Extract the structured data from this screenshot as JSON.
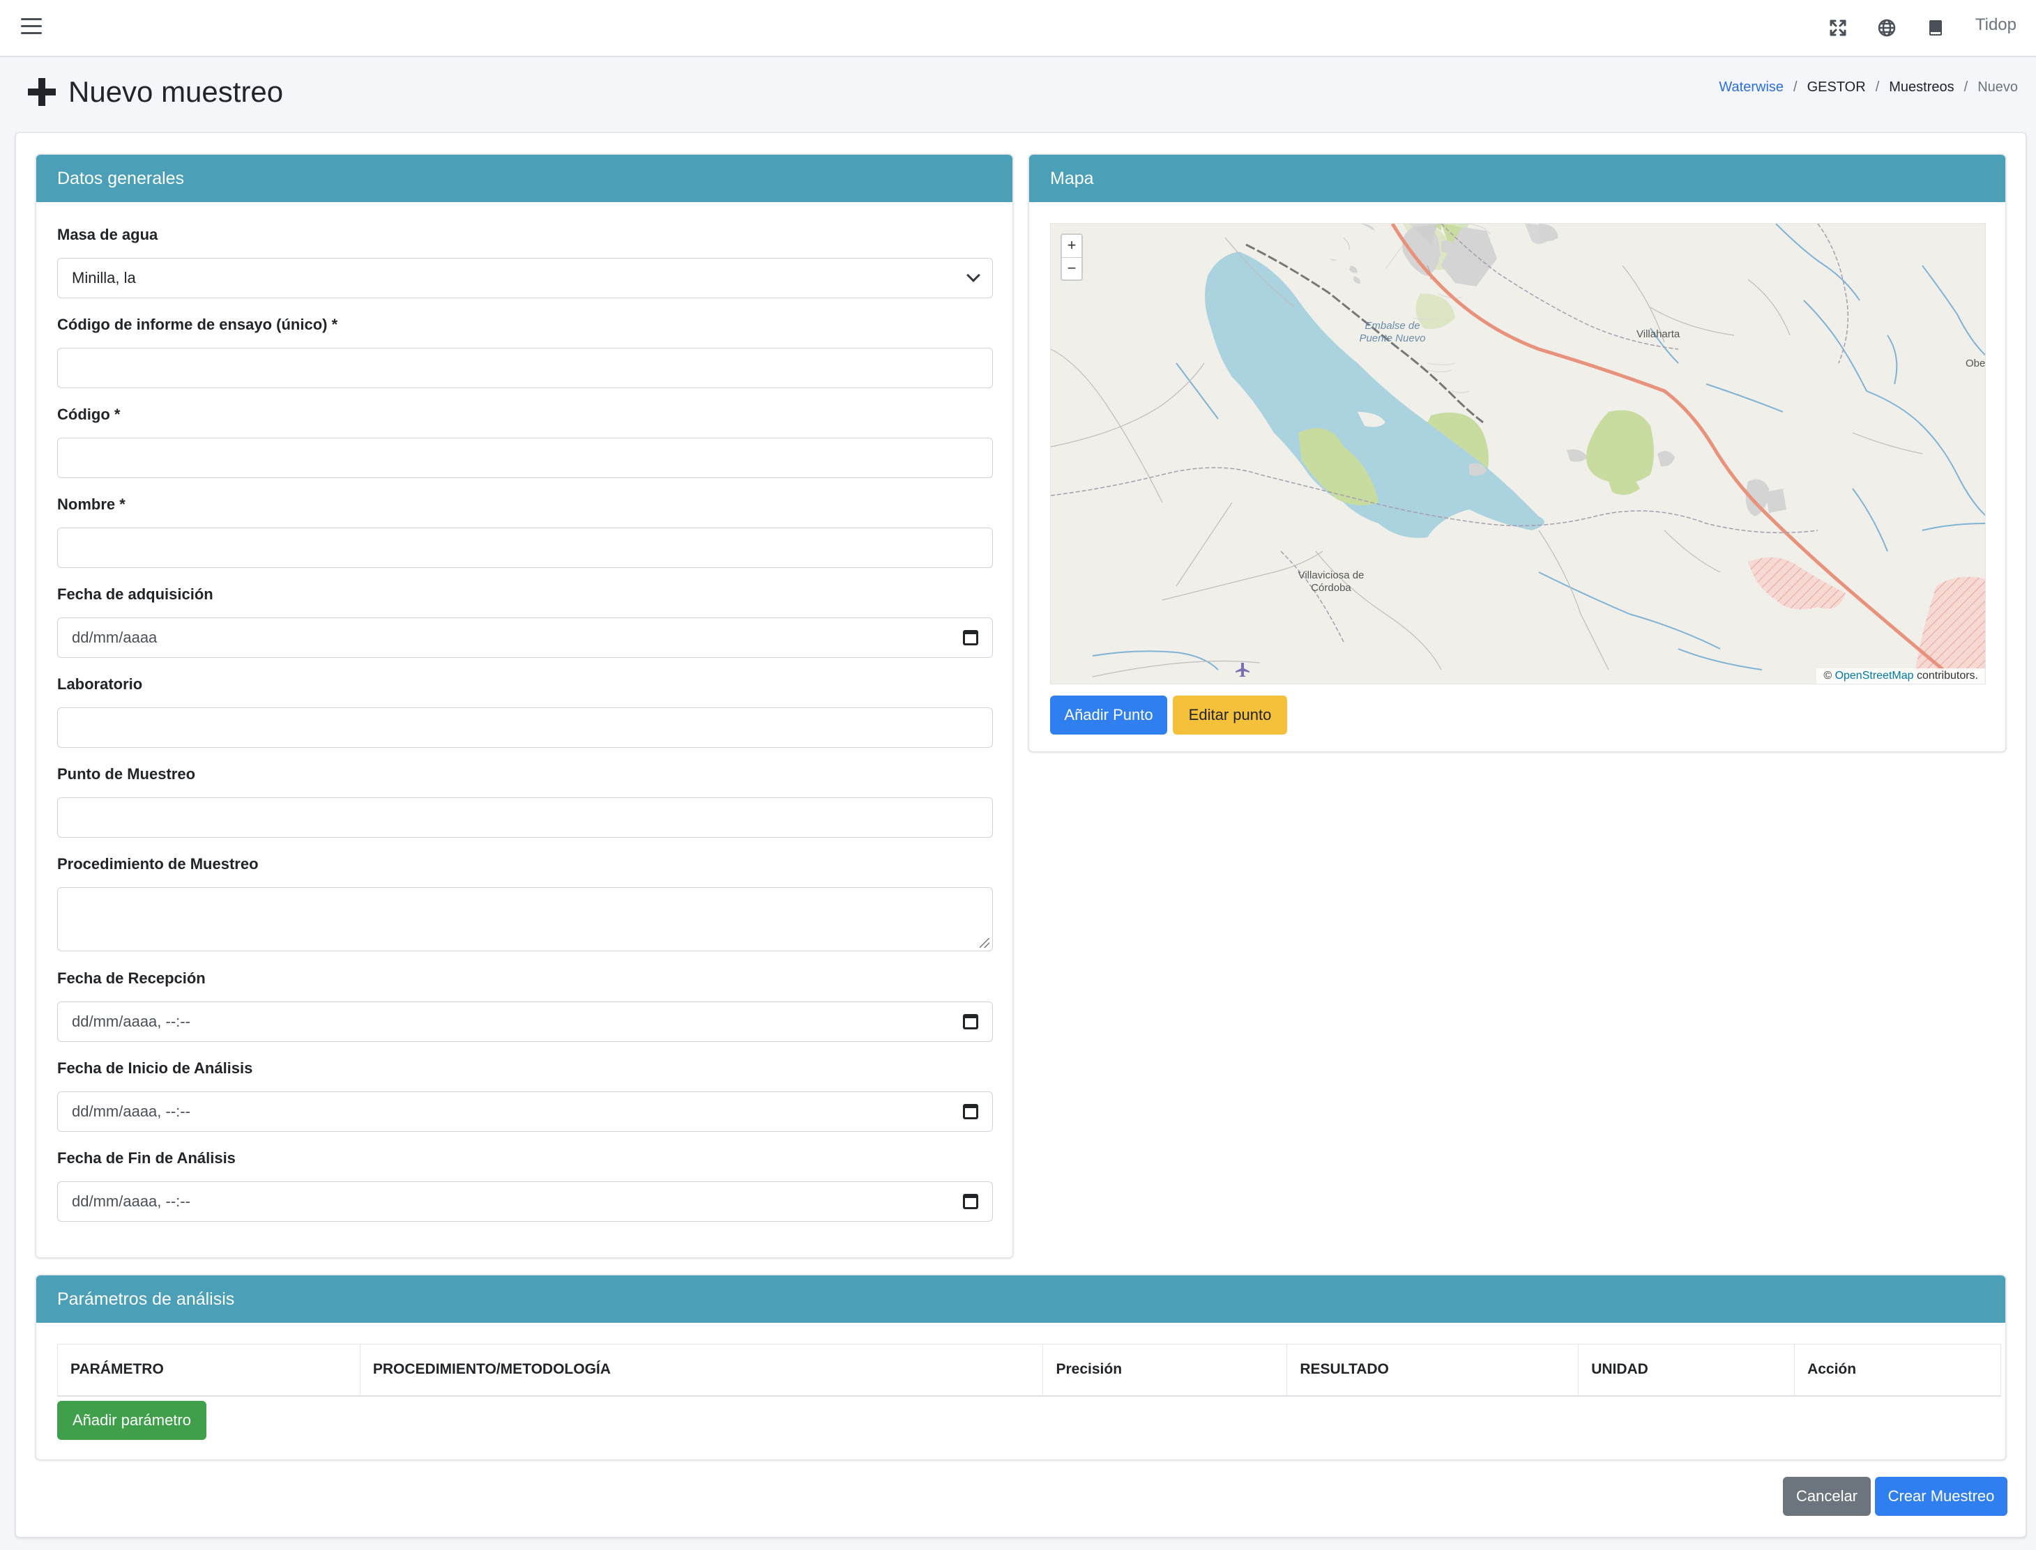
{
  "topbar": {
    "user_label": "Tidop",
    "icons": [
      "menu-icon",
      "fullscreen-icon",
      "globe-icon",
      "book-icon"
    ]
  },
  "page": {
    "title": "Nuevo muestreo",
    "breadcrumb": [
      "Waterwise",
      "GESTOR",
      "Muestreos",
      "Nuevo"
    ]
  },
  "general": {
    "header": "Datos generales",
    "fields": {
      "masa_agua": {
        "label": "Masa de agua",
        "value": "Minilla, la"
      },
      "codigo_informe": {
        "label": "Código de informe de ensayo (único) *",
        "value": ""
      },
      "codigo": {
        "label": "Código *",
        "value": ""
      },
      "nombre": {
        "label": "Nombre *",
        "value": ""
      },
      "fecha_adquisicion": {
        "label": "Fecha de adquisición",
        "value": "dd/mm/aaaa"
      },
      "laboratorio": {
        "label": "Laboratorio",
        "value": ""
      },
      "punto_muestreo": {
        "label": "Punto de Muestreo",
        "value": ""
      },
      "procedimiento": {
        "label": "Procedimiento de Muestreo",
        "value": ""
      },
      "fecha_recepcion": {
        "label": "Fecha de Recepción",
        "value": "dd/mm/aaaa, --:--"
      },
      "fecha_inicio": {
        "label": "Fecha de Inicio de Análisis",
        "value": "dd/mm/aaaa, --:--"
      },
      "fecha_fin": {
        "label": "Fecha de Fin de Análisis",
        "value": "dd/mm/aaaa, --:--"
      }
    }
  },
  "map": {
    "header": "Mapa",
    "zoom_in": "+",
    "zoom_out": "−",
    "attribution_symbol": "©",
    "attribution_link": "OpenStreetMap",
    "attribution_suffix": " contributors.",
    "labels": {
      "reservoir": "Embalse de Puente Nuevo",
      "villaharta": "Villaharta",
      "villaviciosa": "Villaviciosa de Córdoba",
      "obejo": "Obej"
    },
    "add_point": "Añadir Punto",
    "edit_point": "Editar punto",
    "colors": {
      "water": "#abd3df",
      "forest": "#c8dca0",
      "road": "#e8927c"
    }
  },
  "params": {
    "header": "Parámetros de análisis",
    "columns": [
      "PARÁMETRO",
      "PROCEDIMIENTO/METODOLOGÍA",
      "Precisión",
      "RESULTADO",
      "UNIDAD",
      "Acción"
    ],
    "add_label": "Añadir parámetro"
  },
  "actions": {
    "cancel": "Cancelar",
    "create": "Crear Muestreo"
  },
  "colors": {
    "header_bg": "#4b9fb7",
    "primary": "#2f7ff0",
    "warning": "#f5c13a",
    "success": "#3f9f4a",
    "secondary": "#6c757d"
  }
}
